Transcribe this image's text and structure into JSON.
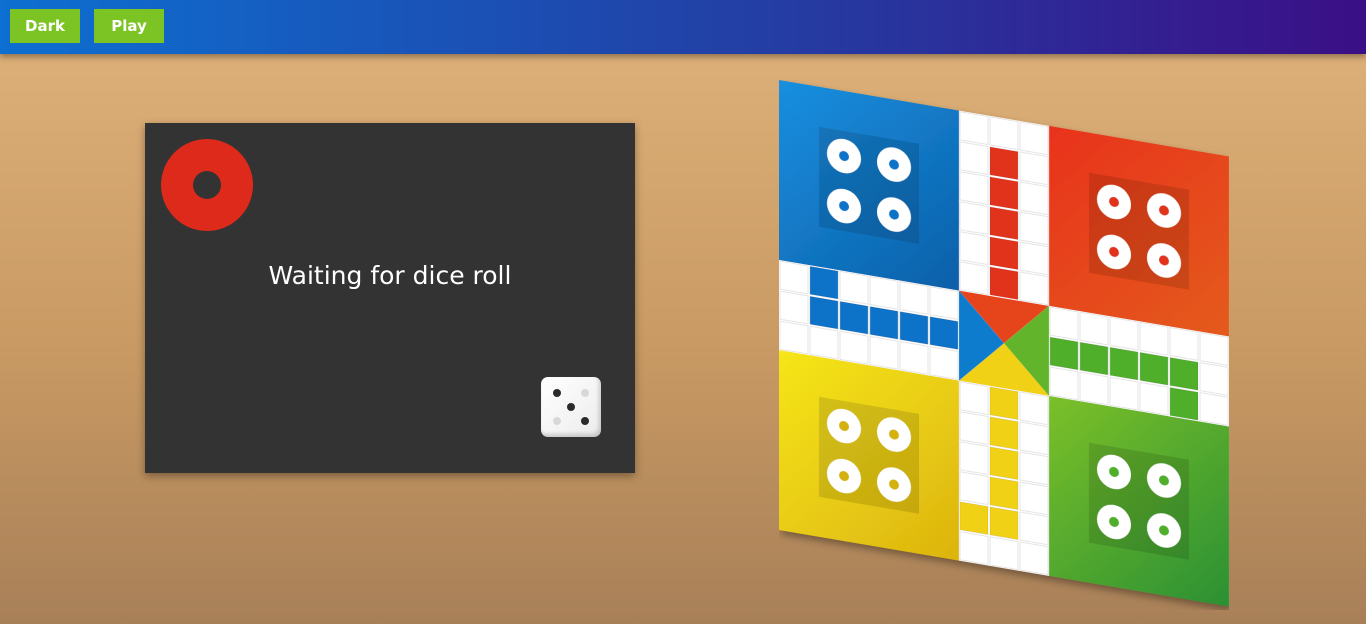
{
  "toolbar": {
    "dark_label": "Dark",
    "play_label": "Play"
  },
  "status_panel": {
    "message": "Waiting for dice roll",
    "current_player_color": "#dd2a1b",
    "dice_face": 3
  },
  "board": {
    "colors": {
      "blue": "#0b73c8",
      "red": "#e1331a",
      "yellow": "#f1d112",
      "green": "#4fae2a"
    },
    "home_tokens_per_player": 4
  }
}
